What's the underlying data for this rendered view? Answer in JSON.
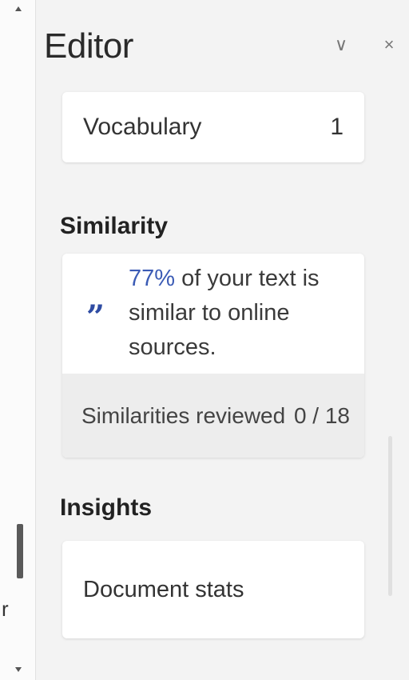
{
  "editor": {
    "title": "Editor",
    "collapse_icon": "chevron-down-icon",
    "close_icon": "close-icon",
    "collapse_glyph": "∨",
    "close_glyph": "×"
  },
  "vocabulary": {
    "label": "Vocabulary",
    "count": "1"
  },
  "similarity": {
    "section_title": "Similarity",
    "icon": "quote-icon",
    "icon_glyph": "”",
    "percent": "77%",
    "message_rest": " of your text is similar to online sources.",
    "reviewed_label": "Similarities reviewed",
    "reviewed_count": "0 / 18",
    "accent_color": "#3b5bb5"
  },
  "insights": {
    "section_title": "Insights",
    "document_stats": "Document stats"
  },
  "left_strip": {
    "char": "r"
  }
}
